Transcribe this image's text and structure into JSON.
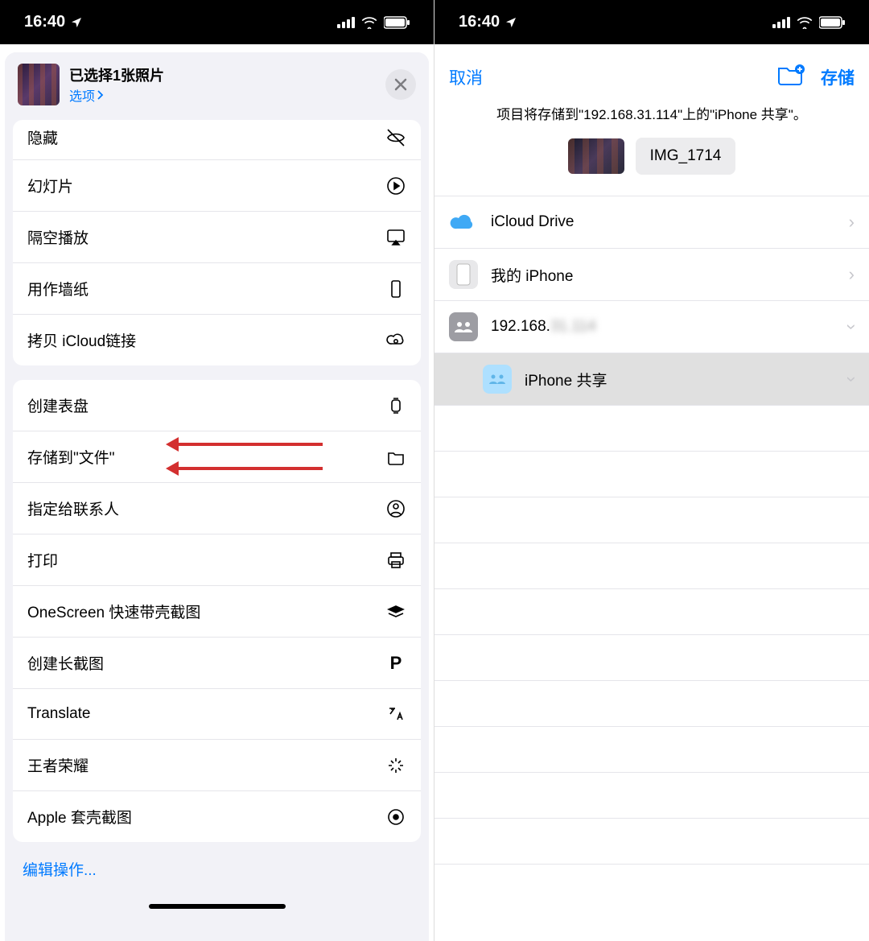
{
  "status_bar": {
    "time": "16:40"
  },
  "left": {
    "header": {
      "title": "已选择1张照片",
      "options_link": "选项"
    },
    "group1": [
      {
        "label": "隐藏",
        "icon": "eye-slash"
      },
      {
        "label": "幻灯片",
        "icon": "play-circle"
      },
      {
        "label": "隔空播放",
        "icon": "airplay"
      },
      {
        "label": "用作墙纸",
        "icon": "phone-outline"
      },
      {
        "label": "拷贝 iCloud链接",
        "icon": "cloud-link"
      }
    ],
    "group2": [
      {
        "label": "创建表盘",
        "icon": "watch"
      },
      {
        "label": "存储到\"文件\"",
        "icon": "folder"
      },
      {
        "label": "指定给联系人",
        "icon": "person-circle"
      },
      {
        "label": "打印",
        "icon": "printer"
      },
      {
        "label": "OneScreen  快速带壳截图",
        "icon": "layers"
      },
      {
        "label": "创建长截图",
        "icon": "p-glyph"
      },
      {
        "label": "Translate",
        "icon": "translate"
      },
      {
        "label": "王者荣耀",
        "icon": "sparkle"
      },
      {
        "label": "Apple 套壳截图",
        "icon": "target"
      }
    ],
    "edit_actions_label": "编辑操作..."
  },
  "right": {
    "nav": {
      "cancel": "取消",
      "save": "存储"
    },
    "hint": "项目将存储到\"192.168.31.114\"上的\"iPhone 共享\"。",
    "filename": "IMG_1714",
    "locations": [
      {
        "label": "iCloud Drive",
        "icon": "icloud",
        "chevron": "right"
      },
      {
        "label": "我的 iPhone",
        "icon": "iphone",
        "chevron": "right"
      },
      {
        "label": "192.168.",
        "partial": true,
        "icon": "server-users",
        "chevron": "down"
      },
      {
        "label": "iPhone 共享",
        "icon": "shared-folder",
        "chevron": "down",
        "selected": true,
        "indent": true
      }
    ]
  }
}
